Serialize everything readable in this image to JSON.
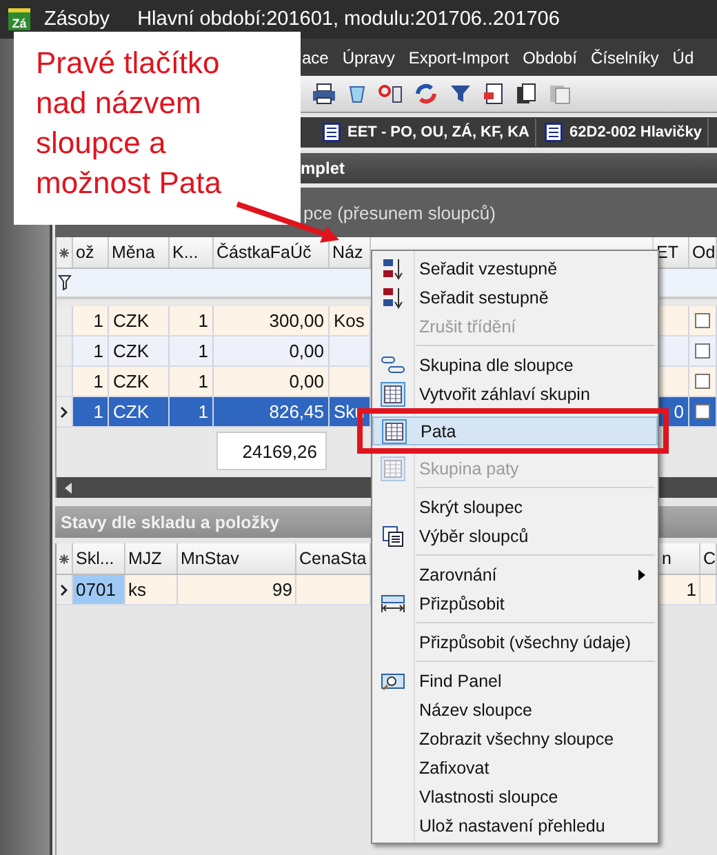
{
  "window": {
    "logo_text": "Zá",
    "app": "Zásoby",
    "title": "Hlavní období:201601, modulu:201706..201706"
  },
  "menu_bar": [
    "ace",
    "Úpravy",
    "Export-Import",
    "Období",
    "Číselníky",
    "Úd"
  ],
  "tabs": [
    {
      "label": "EET - PO, OU, ZÁ, KF, KA",
      "selected": false
    },
    {
      "label": "62D2-002 Hlavičky",
      "selected": false
    }
  ],
  "panel_title": "mplet",
  "group_panel": "pce (přesunem sloupců)",
  "grid": {
    "columns": [
      "ož",
      "Měna",
      "K...",
      "ČástkaFaÚč",
      "Náz",
      "ET",
      "Od"
    ],
    "rows": [
      {
        "cells": [
          "1",
          "CZK",
          "1",
          "300,00",
          "Kos",
          "",
          ""
        ],
        "selected": false,
        "checked": false
      },
      {
        "cells": [
          "1",
          "CZK",
          "1",
          "0,00",
          "",
          "",
          ""
        ],
        "selected": false,
        "checked": false
      },
      {
        "cells": [
          "1",
          "CZK",
          "1",
          "0,00",
          "",
          "",
          ""
        ],
        "selected": false,
        "checked": false
      },
      {
        "cells": [
          "1",
          "CZK",
          "1",
          "826,45",
          "Sku",
          "0",
          ""
        ],
        "selected": true,
        "checked": false
      }
    ],
    "footer_total": "24169,26"
  },
  "lower_panel": {
    "title": "Stavy dle skladu a položky",
    "columns": [
      "Skl...",
      "MJZ",
      "MnStav",
      "CenaSta",
      "n",
      "C"
    ],
    "rows": [
      {
        "cells": [
          "0701",
          "ks",
          "99",
          "",
          "1",
          ""
        ],
        "selected": true
      }
    ]
  },
  "context_menu": [
    {
      "label": "Seřadit vzestupně",
      "disabled": false,
      "selected": false,
      "separator_before": false,
      "submenu": false
    },
    {
      "label": "Seřadit sestupně",
      "disabled": false,
      "selected": false,
      "separator_before": false,
      "submenu": false
    },
    {
      "label": "Zrušit třídění",
      "disabled": true,
      "selected": false,
      "separator_before": false,
      "submenu": false
    },
    {
      "label": "Skupina dle sloupce",
      "disabled": false,
      "selected": false,
      "separator_before": true,
      "submenu": false
    },
    {
      "label": "Vytvořit záhlaví skupin",
      "disabled": false,
      "selected": false,
      "separator_before": false,
      "submenu": false
    },
    {
      "label": "Pata",
      "disabled": false,
      "selected": true,
      "separator_before": false,
      "submenu": false
    },
    {
      "label": "Skupina paty",
      "disabled": true,
      "selected": false,
      "separator_before": false,
      "submenu": false
    },
    {
      "label": "Skrýt sloupec",
      "disabled": false,
      "selected": false,
      "separator_before": true,
      "submenu": false
    },
    {
      "label": "Výběr sloupců",
      "disabled": false,
      "selected": false,
      "separator_before": false,
      "submenu": false
    },
    {
      "label": "Zarovnání",
      "disabled": false,
      "selected": false,
      "separator_before": true,
      "submenu": true
    },
    {
      "label": "Přizpůsobit",
      "disabled": false,
      "selected": false,
      "separator_before": false,
      "submenu": false
    },
    {
      "label": "Přizpůsobit (všechny údaje)",
      "disabled": false,
      "selected": false,
      "separator_before": true,
      "submenu": false
    },
    {
      "label": "Find Panel",
      "disabled": false,
      "selected": false,
      "separator_before": true,
      "submenu": false
    },
    {
      "label": "Název sloupce",
      "disabled": false,
      "selected": false,
      "separator_before": false,
      "submenu": false
    },
    {
      "label": "Zobrazit všechny sloupce",
      "disabled": false,
      "selected": false,
      "separator_before": false,
      "submenu": false
    },
    {
      "label": "Zafixovat",
      "disabled": false,
      "selected": false,
      "separator_before": false,
      "submenu": false
    },
    {
      "label": "Vlastnosti sloupce",
      "disabled": false,
      "selected": false,
      "separator_before": false,
      "submenu": false
    },
    {
      "label": "Ulož nastavení přehledu",
      "disabled": false,
      "selected": false,
      "separator_before": false,
      "submenu": false
    }
  ],
  "annotation": {
    "text": "Pravé tlačítko nad názvem sloupce a možnost Pata"
  }
}
